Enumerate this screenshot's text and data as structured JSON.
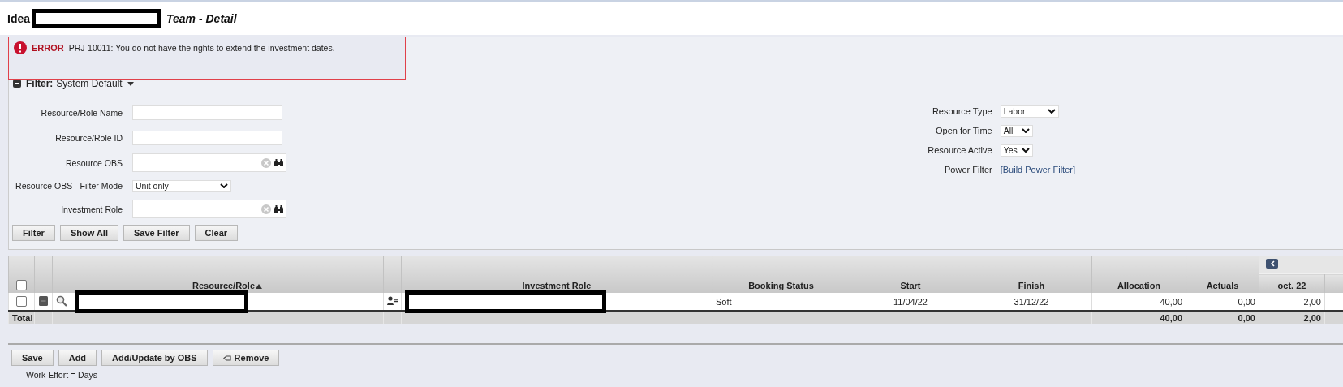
{
  "page": {
    "title_prefix": "Idea",
    "title_suffix": "Team - Detail"
  },
  "error": {
    "label": "ERROR",
    "message": "PRJ-10011: You do not have the rights to extend the investment dates."
  },
  "filter": {
    "title": "Filter:",
    "name": "System Default",
    "expanded": true,
    "left_fields": [
      {
        "label": "Resource/Role Name",
        "kind": "text"
      },
      {
        "label": "Resource/Role ID",
        "kind": "text"
      },
      {
        "label": "Resource OBS",
        "kind": "lookup"
      },
      {
        "label": "Resource OBS - Filter Mode",
        "kind": "select",
        "value": "Unit only"
      },
      {
        "label": "Investment Role",
        "kind": "lookup"
      }
    ],
    "right_fields": [
      {
        "label": "Resource Type",
        "kind": "select",
        "value": "Labor"
      },
      {
        "label": "Open for Time",
        "kind": "select",
        "value": "All"
      },
      {
        "label": "Resource Active",
        "kind": "select",
        "value": "Yes"
      },
      {
        "label": "Power Filter",
        "kind": "link",
        "value": "[Build Power Filter]"
      }
    ],
    "buttons": [
      "Filter",
      "Show All",
      "Save Filter",
      "Clear"
    ]
  },
  "table": {
    "select_all_checked": false,
    "columns": [
      {
        "label": "Resource/Role",
        "sorted": true
      },
      {
        "label": "Investment Role"
      },
      {
        "label": "Booking Status"
      },
      {
        "label": "Start"
      },
      {
        "label": "Finish"
      },
      {
        "label": "Allocation"
      },
      {
        "label": "Actuals"
      },
      {
        "label": "oct. 22"
      }
    ],
    "rows": [
      {
        "checked": false,
        "booking_status": "Soft",
        "start": "11/04/22",
        "finish": "31/12/22",
        "allocation": "40,00",
        "actuals": "0,00",
        "oct_22": "2,00"
      }
    ],
    "total": {
      "label": "Total",
      "allocation": "40,00",
      "actuals": "0,00",
      "oct_22": "2,00"
    }
  },
  "actions": [
    {
      "label": "Save",
      "kind": "plain"
    },
    {
      "label": "Add",
      "kind": "plain"
    },
    {
      "label": "Add/Update by OBS",
      "kind": "plain"
    },
    {
      "label": "Remove",
      "kind": "remove"
    }
  ],
  "footer": "Work Effort = Days"
}
